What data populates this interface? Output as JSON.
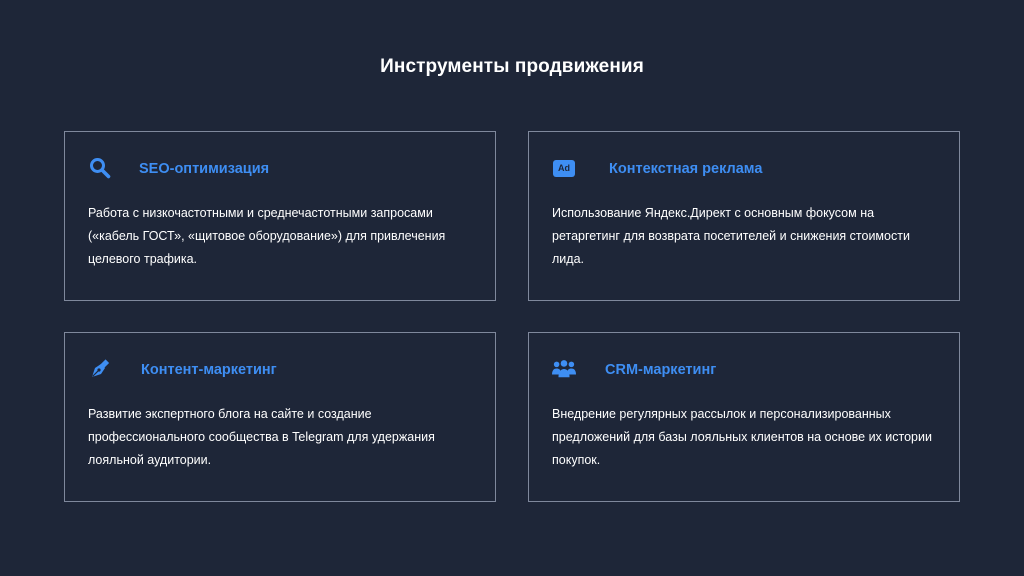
{
  "page": {
    "title": "Инструменты продвижения"
  },
  "accent_color": "#3e8ef3",
  "background_color": "#1e2638",
  "cards": [
    {
      "icon": "search-icon",
      "heading": "SEO-оптимизация",
      "text": "Работа с низкочастотными и среднечастотными запросами («кабель ГОСТ», «щитовое оборудование») для привлечения целевого трафика."
    },
    {
      "icon": "ad-icon",
      "icon_text": "Ad",
      "heading": "Контекстная реклама",
      "text": "Использование Яндекс.Директ с основным фокусом на ретаргетинг для возврата посетителей и снижения стоимости лида."
    },
    {
      "icon": "pen-nib-icon",
      "heading": "Контент-маркетинг",
      "text": "Развитие экспертного блога на сайте и создание профессионального сообщества в Telegram для удержания лояльной аудитории."
    },
    {
      "icon": "users-icon",
      "heading": "CRM-маркетинг",
      "text": "Внедрение регулярных рассылок и персонализированных предложений для базы лояльных клиентов на основе их истории покупок."
    }
  ]
}
